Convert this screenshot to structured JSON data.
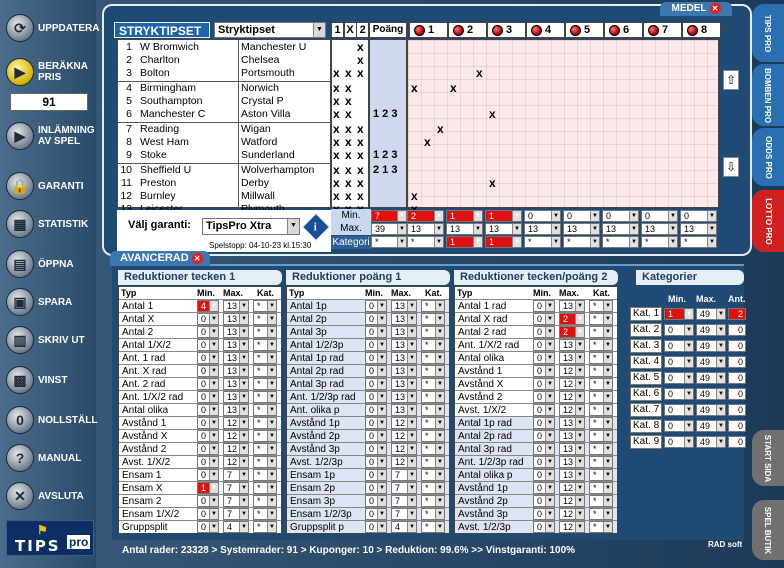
{
  "sidebar": {
    "items": [
      {
        "label": "UPPDATERA",
        "icon": "refresh-icon"
      },
      {
        "label": "BERÄKNA PRIS",
        "icon": "play-icon"
      },
      {
        "label": "INLÄMNING AV SPEL",
        "icon": "play-icon"
      },
      {
        "label": "GARANTI",
        "icon": "lock-icon"
      },
      {
        "label": "STATISTIK",
        "icon": "table-icon"
      },
      {
        "label": "ÖPPNA",
        "icon": "document-icon"
      },
      {
        "label": "SPARA",
        "icon": "floppy-icon"
      },
      {
        "label": "SKRIV UT",
        "icon": "printer-icon"
      },
      {
        "label": "VINST",
        "icon": "calculator-icon"
      },
      {
        "label": "NOLLSTÄLL",
        "icon": "zero-icon"
      },
      {
        "label": "MANUAL",
        "icon": "help-icon"
      },
      {
        "label": "AVSLUTA",
        "icon": "exit-icon"
      }
    ],
    "price": "91",
    "logo": {
      "main": "TIPS",
      "sub": "pro"
    }
  },
  "right_tabs": [
    {
      "label": "TIPS PRO",
      "color": "#2a6fb0"
    },
    {
      "label": "BOMBEN PRO",
      "color": "#2a6fb0"
    },
    {
      "label": "ODDS PRO",
      "color": "#2a6fb0"
    },
    {
      "label": "LOTTO PRO",
      "color": "#d02020"
    },
    {
      "label": "START SIDA",
      "color": "#707070"
    },
    {
      "label": "SPEL BUTIK",
      "color": "#707070"
    }
  ],
  "top": {
    "medel_tab": "MEDEL",
    "title": "STRYKTIPSET",
    "game_select": "Stryktipset",
    "col_1x2": [
      "1",
      "X",
      "2"
    ],
    "col_points": "Poäng",
    "systems": [
      "1",
      "2",
      "3",
      "4",
      "5",
      "6",
      "7",
      "8"
    ],
    "matches": [
      {
        "n": "1",
        "home": "W Bromwich",
        "away": "Manchester U"
      },
      {
        "n": "2",
        "home": "Charlton",
        "away": "Chelsea"
      },
      {
        "n": "3",
        "home": "Bolton",
        "away": "Portsmouth"
      },
      {
        "n": "4",
        "home": "Birmingham",
        "away": "Norwich"
      },
      {
        "n": "5",
        "home": "Southampton",
        "away": "Crystal P"
      },
      {
        "n": "6",
        "home": "Manchester C",
        "away": "Aston Villa"
      },
      {
        "n": "7",
        "home": "Reading",
        "away": "Wigan"
      },
      {
        "n": "8",
        "home": "West Ham",
        "away": "Watford"
      },
      {
        "n": "9",
        "home": "Stoke",
        "away": "Sunderland"
      },
      {
        "n": "10",
        "home": "Sheffield U",
        "away": "Wolverhampton"
      },
      {
        "n": "11",
        "home": "Preston",
        "away": "Derby"
      },
      {
        "n": "12",
        "home": "Burnley",
        "away": "Millwall"
      },
      {
        "n": "13",
        "home": "Leicester",
        "away": "Plymouth"
      }
    ],
    "marks_1x2": [
      [
        "",
        "",
        "x"
      ],
      [
        "",
        "",
        "x"
      ],
      [
        "x",
        "x",
        "x"
      ],
      [
        "x",
        "x",
        ""
      ],
      [
        "x",
        "x",
        ""
      ],
      [
        "x",
        "x",
        ""
      ],
      [
        "x",
        "x",
        "x"
      ],
      [
        "x",
        "x",
        "x"
      ],
      [
        "x",
        "x",
        "x"
      ],
      [
        "x",
        "x",
        "x"
      ],
      [
        "x",
        "x",
        "x"
      ],
      [
        "x",
        "x",
        "x"
      ],
      [
        "x",
        "x",
        "x"
      ]
    ],
    "points_rows": [
      {
        "row": 6,
        "text": "1 2 3"
      },
      {
        "row": 9,
        "text": "1 2 3"
      },
      {
        "row": 10,
        "text": "2 1 3"
      }
    ],
    "system_marks": [
      {
        "row": 3,
        "col": 5
      },
      {
        "row": 4,
        "col": 0
      },
      {
        "row": 4,
        "col": 3
      },
      {
        "row": 6,
        "col": 6
      },
      {
        "row": 7,
        "col": 2
      },
      {
        "row": 8,
        "col": 1
      },
      {
        "row": 11,
        "col": 6
      },
      {
        "row": 12,
        "col": 0
      },
      {
        "row": 13,
        "col": 0
      }
    ],
    "garanti_label": "Välj garanti:",
    "garanti_value": "TipsPro Xtra",
    "spelstopp": "Spelstopp: 04-10-23 kl.15:30",
    "min_label": "Min.",
    "max_label": "Max.",
    "kategori_label": "Kategori",
    "min_values": [
      "7",
      "2",
      "1",
      "1",
      "0",
      "0",
      "0",
      "0",
      "0"
    ],
    "max_values": [
      "39",
      "13",
      "13",
      "13",
      "13",
      "13",
      "13",
      "13",
      "13"
    ],
    "kat_values": [
      "*",
      "*",
      "1",
      "1",
      "*",
      "*",
      "*",
      "*",
      "*"
    ]
  },
  "advanced": {
    "tab": "AVANCERAD",
    "hdr": {
      "typ": "Typ",
      "min": "Min.",
      "max": "Max.",
      "kat": "Kat."
    },
    "blocks": [
      {
        "title": "Reduktioner tecken 1",
        "rows": [
          [
            "Antal 1",
            "4",
            "13",
            "*"
          ],
          [
            "Antal X",
            "0",
            "13",
            "*"
          ],
          [
            "Antal 2",
            "0",
            "13",
            "*"
          ],
          [
            "Antal 1/X/2",
            "0",
            "13",
            "*"
          ],
          [
            "Ant. 1 rad",
            "0",
            "13",
            "*"
          ],
          [
            "Ant. X rad",
            "0",
            "13",
            "*"
          ],
          [
            "Ant. 2 rad",
            "0",
            "13",
            "*"
          ],
          [
            "Ant. 1/X/2 rad",
            "0",
            "13",
            "*"
          ],
          [
            "Antal olika",
            "0",
            "13",
            "*"
          ],
          [
            "Avstånd 1",
            "0",
            "12",
            "*"
          ],
          [
            "Avstånd X",
            "0",
            "12",
            "*"
          ],
          [
            "Avstånd 2",
            "0",
            "12",
            "*"
          ],
          [
            "Avst. 1/X/2",
            "0",
            "12",
            "*"
          ],
          [
            "Ensam 1",
            "0",
            "7",
            "*"
          ],
          [
            "Ensam X",
            "1",
            "7",
            "*"
          ],
          [
            "Ensam 2",
            "0",
            "7",
            "*"
          ],
          [
            "Ensam 1/X/2",
            "0",
            "7",
            "*"
          ],
          [
            "Gruppsplit",
            "0",
            "4",
            "*"
          ]
        ]
      },
      {
        "title": "Reduktioner poäng 1",
        "rows": [
          [
            "Antal 1p",
            "0",
            "13",
            "*"
          ],
          [
            "Antal 2p",
            "0",
            "13",
            "*"
          ],
          [
            "Antal 3p",
            "0",
            "13",
            "*"
          ],
          [
            "Antal 1/2/3p",
            "0",
            "13",
            "*"
          ],
          [
            "Antal 1p rad",
            "0",
            "13",
            "*"
          ],
          [
            "Antal 2p rad",
            "0",
            "13",
            "*"
          ],
          [
            "Antal 3p rad",
            "0",
            "13",
            "*"
          ],
          [
            "Ant. 1/2/3p rad",
            "0",
            "13",
            "*"
          ],
          [
            "Ant. olika p",
            "0",
            "13",
            "*"
          ],
          [
            "Avstånd 1p",
            "0",
            "12",
            "*"
          ],
          [
            "Avstånd 2p",
            "0",
            "12",
            "*"
          ],
          [
            "Avstånd 3p",
            "0",
            "12",
            "*"
          ],
          [
            "Avst. 1/2/3p",
            "0",
            "12",
            "*"
          ],
          [
            "Ensam 1p",
            "0",
            "7",
            "*"
          ],
          [
            "Ensam 2p",
            "0",
            "7",
            "*"
          ],
          [
            "Ensam 3p",
            "0",
            "7",
            "*"
          ],
          [
            "Ensam 1/2/3p",
            "0",
            "7",
            "*"
          ],
          [
            "Gruppsplit p",
            "0",
            "4",
            "*"
          ]
        ]
      },
      {
        "title": "Reduktioner tecken/poäng 2",
        "rows": [
          [
            "Antal 1 rad",
            "0",
            "13",
            "*"
          ],
          [
            "Antal X rad",
            "0",
            "2",
            "*"
          ],
          [
            "Antal 2 rad",
            "0",
            "2",
            "*"
          ],
          [
            "Ant. 1/X/2 rad",
            "0",
            "13",
            "*"
          ],
          [
            "Antal olika",
            "0",
            "13",
            "*"
          ],
          [
            "Avstånd 1",
            "0",
            "12",
            "*"
          ],
          [
            "Avstånd X",
            "0",
            "12",
            "*"
          ],
          [
            "Avstånd 2",
            "0",
            "12",
            "*"
          ],
          [
            "Avst. 1/X/2",
            "0",
            "12",
            "*"
          ],
          [
            "Antal 1p rad",
            "0",
            "13",
            "*"
          ],
          [
            "Antal 2p rad",
            "0",
            "13",
            "*"
          ],
          [
            "Antal 3p rad",
            "0",
            "13",
            "*"
          ],
          [
            "Ant. 1/2/3p rad",
            "0",
            "13",
            "*"
          ],
          [
            "Antal olika p",
            "0",
            "13",
            "*"
          ],
          [
            "Avstånd 1p",
            "0",
            "12",
            "*"
          ],
          [
            "Avstånd 2p",
            "0",
            "12",
            "*"
          ],
          [
            "Avstånd 3p",
            "0",
            "12",
            "*"
          ],
          [
            "Avst. 1/2/3p",
            "0",
            "12",
            "*"
          ]
        ]
      }
    ],
    "kategorier": {
      "title": "Kategorier",
      "hdr": {
        "min": "Min.",
        "max": "Max.",
        "ant": "Ant."
      },
      "rows": [
        [
          "Kat. 1",
          "1",
          "49",
          "2"
        ],
        [
          "Kat. 2",
          "0",
          "49",
          "0"
        ],
        [
          "Kat. 3",
          "0",
          "49",
          "0"
        ],
        [
          "Kat. 4",
          "0",
          "49",
          "0"
        ],
        [
          "Kat. 5",
          "0",
          "49",
          "0"
        ],
        [
          "Kat. 6",
          "0",
          "49",
          "0"
        ],
        [
          "Kat. 7",
          "0",
          "49",
          "0"
        ],
        [
          "Kat. 8",
          "0",
          "49",
          "0"
        ],
        [
          "Kat. 9",
          "0",
          "49",
          "0"
        ]
      ]
    }
  },
  "status": "Antal rader: 23328  >  Systemrader: 91  >  Kuponger: 10  >  Reduktion: 99.6%  >>  Vinstgaranti: 100%",
  "radsoft": "RAD soft"
}
